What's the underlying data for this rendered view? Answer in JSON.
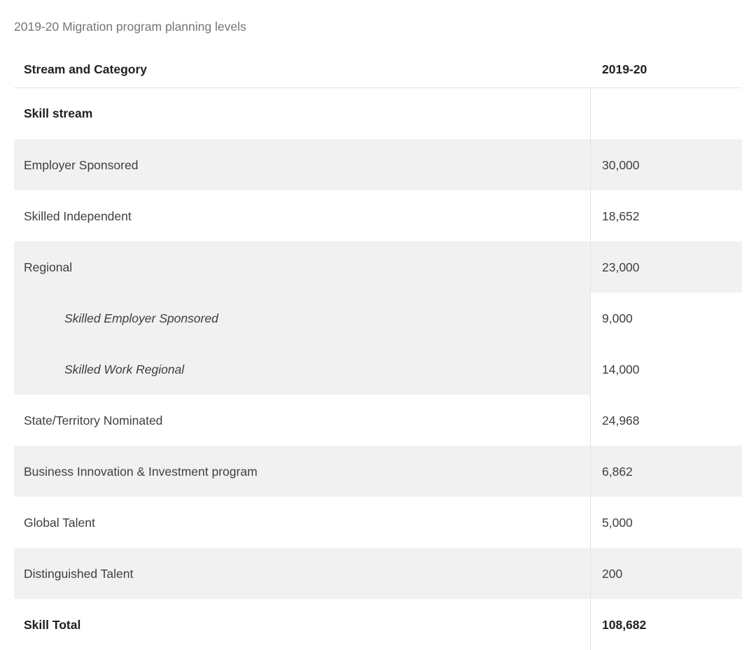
{
  "caption": "2019-20 Migration program planning levels",
  "colors": {
    "shade": "#f1f1f1",
    "rule": "#e4e4e4",
    "divider": "#e2e2e2",
    "caption_text": "#767676",
    "body_text": "#3c4043",
    "strong_text": "#202124"
  },
  "table": {
    "columns": [
      {
        "key": "stream_and_category",
        "label": "Stream and Category"
      },
      {
        "key": "year",
        "label": "2019-20"
      }
    ],
    "rows": [
      {
        "type": "section",
        "label": "Skill stream",
        "value": "",
        "shaded_label": false,
        "shaded_value": false,
        "indent": false
      },
      {
        "type": "data",
        "label": "Employer Sponsored",
        "value": "30,000",
        "shaded_label": true,
        "shaded_value": true,
        "indent": false
      },
      {
        "type": "data",
        "label": "Skilled Independent",
        "value": "18,652",
        "shaded_label": false,
        "shaded_value": false,
        "indent": false
      },
      {
        "type": "data",
        "label": "Regional",
        "value": "23,000",
        "shaded_label": true,
        "shaded_value": true,
        "indent": false
      },
      {
        "type": "subdata",
        "label": "Skilled Employer Sponsored",
        "value": "9,000",
        "shaded_label": true,
        "shaded_value": false,
        "indent": true
      },
      {
        "type": "subdata",
        "label": "Skilled Work Regional",
        "value": "14,000",
        "shaded_label": true,
        "shaded_value": false,
        "indent": true
      },
      {
        "type": "data",
        "label": "State/Territory Nominated",
        "value": "24,968",
        "shaded_label": false,
        "shaded_value": false,
        "indent": false
      },
      {
        "type": "data",
        "label": "Business Innovation & Investment program",
        "value": "6,862",
        "shaded_label": true,
        "shaded_value": true,
        "indent": false
      },
      {
        "type": "data",
        "label": "Global Talent",
        "value": "5,000",
        "shaded_label": false,
        "shaded_value": false,
        "indent": false
      },
      {
        "type": "data",
        "label": "Distinguished Talent",
        "value": "200",
        "shaded_label": true,
        "shaded_value": true,
        "indent": false
      },
      {
        "type": "total",
        "label": "Skill Total",
        "value": "108,682",
        "shaded_label": false,
        "shaded_value": false,
        "indent": false
      }
    ]
  }
}
